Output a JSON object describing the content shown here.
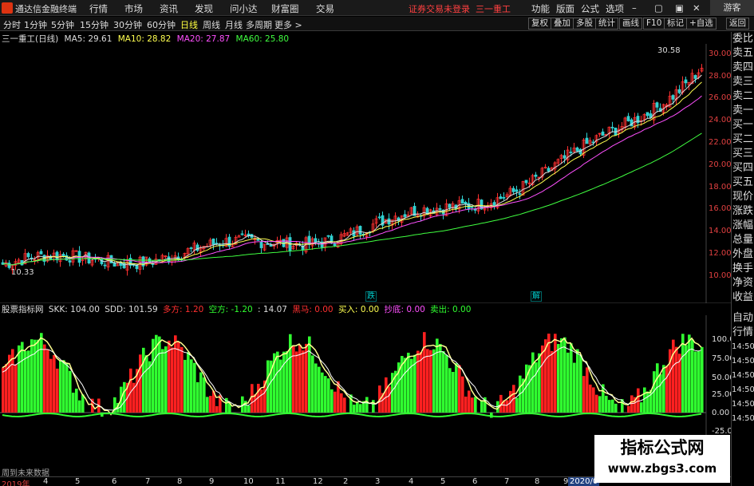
{
  "menubar": {
    "app_title": "通达信金融终端",
    "menus": [
      "行情",
      "市场",
      "资讯",
      "发现",
      "问小达",
      "财富圈",
      "交易"
    ],
    "notice": "证券交易未登录",
    "stock": "三一重工",
    "right": [
      "功能",
      "版面",
      "公式",
      "选项"
    ],
    "guest": "游客"
  },
  "toolbar": {
    "timeframes": [
      "分时",
      "1分钟",
      "5分钟",
      "15分钟",
      "30分钟",
      "60分钟",
      "日线",
      "周线",
      "月线",
      "多周期",
      "更多 >"
    ],
    "active": "日线",
    "right_buttons": [
      "复权",
      "叠加",
      "多股",
      "统计",
      "画线",
      "F10",
      "标记",
      "+自选",
      "返回"
    ]
  },
  "legend": {
    "stock": "三一重工(日线)",
    "ma5": "MA5: 29.61",
    "ma10": "MA10: 28.82",
    "ma20": "MA20: 27.87",
    "ma60": "MA60: 25.80"
  },
  "price_axis": [
    "30.00",
    "28.00",
    "26.00",
    "24.00",
    "22.00",
    "20.00",
    "18.00",
    "16.00",
    "14.00",
    "12.00",
    "10.00"
  ],
  "price_high_label": "30.58",
  "price_low_label": "10.33",
  "markers": {
    "m1": "跌",
    "m2": "解"
  },
  "indicator": {
    "name": "股票指标网",
    "skk": "SKK: 104.00",
    "sdd": "SDD: 101.59",
    "duo": "多方: 1.20",
    "kong": "空方: -1.20",
    "v": ": 14.07",
    "heima": "黑马: 0.00",
    "buy": "买入: 0.00",
    "chaodi": "抄底: 0.00",
    "sell": "卖出: 0.00"
  },
  "ind_axis": [
    "100.00",
    "75.00",
    "50.00",
    "25.00",
    "0.00",
    "-25.00"
  ],
  "side_panel": [
    "委比",
    "卖五",
    "卖四",
    "卖三",
    "卖二",
    "卖一",
    "买一",
    "买二",
    "买三",
    "买四",
    "买五",
    "现价",
    "涨跌",
    "涨幅",
    "总量",
    "外盘",
    "换手",
    "净资",
    "收益",
    "",
    "自动",
    "行情",
    "14:50",
    "14:50",
    "14:50",
    "14:50",
    "14:50",
    "14:50"
  ],
  "date_axis": [
    "2019年",
    "4",
    "5",
    "6",
    "7",
    "8",
    "9",
    "10",
    "11",
    "12",
    "2",
    "3",
    "4",
    "5",
    "6",
    "7",
    "8",
    "9",
    "10",
    "2020/0"
  ],
  "foot_note": "周到未来数据",
  "watermark": {
    "line1": "指标公式网",
    "line2": "www.zbgs3.com"
  },
  "colors": {
    "up": "#ff3030",
    "down": "#30ff30",
    "ma5": "#dddddd",
    "ma10": "#ffff50",
    "ma20": "#ff50ff",
    "ma60": "#40ff40"
  }
}
